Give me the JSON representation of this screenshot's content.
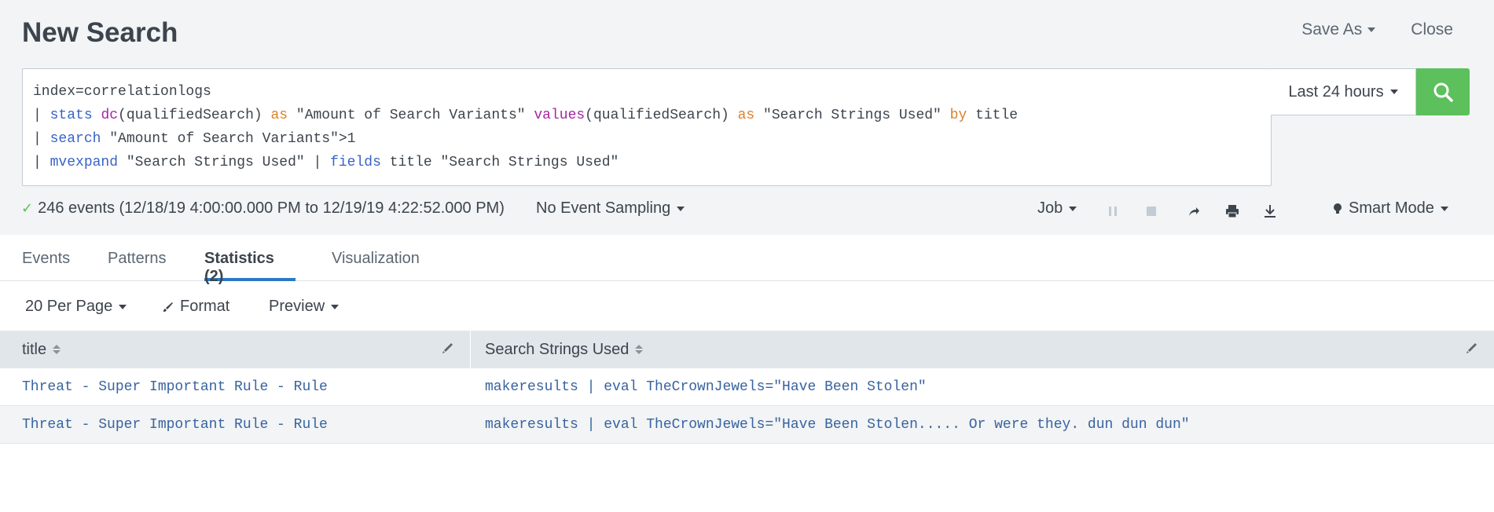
{
  "header": {
    "title": "New Search",
    "save_as": "Save As",
    "close": "Close"
  },
  "search": {
    "lines": [
      [
        {
          "t": "index=correlationlogs",
          "c": ""
        }
      ],
      [
        {
          "t": "| ",
          "c": ""
        },
        {
          "t": "stats",
          "c": "blue"
        },
        {
          "t": " ",
          "c": ""
        },
        {
          "t": "dc",
          "c": "purple"
        },
        {
          "t": "(qualifiedSearch) ",
          "c": ""
        },
        {
          "t": "as",
          "c": "orange"
        },
        {
          "t": " \"Amount of Search Variants\" ",
          "c": ""
        },
        {
          "t": "values",
          "c": "purple"
        },
        {
          "t": "(qualifiedSearch) ",
          "c": ""
        },
        {
          "t": "as",
          "c": "orange"
        },
        {
          "t": " \"Search Strings Used\" ",
          "c": ""
        },
        {
          "t": "by",
          "c": "orange"
        },
        {
          "t": " title",
          "c": ""
        }
      ],
      [
        {
          "t": "| ",
          "c": ""
        },
        {
          "t": "search",
          "c": "blue"
        },
        {
          "t": " \"Amount of Search Variants\">1",
          "c": ""
        }
      ],
      [
        {
          "t": "| ",
          "c": ""
        },
        {
          "t": "mvexpand",
          "c": "blue"
        },
        {
          "t": " \"Search Strings Used\" | ",
          "c": ""
        },
        {
          "t": "fields",
          "c": "blue"
        },
        {
          "t": " title \"Search Strings Used\"",
          "c": ""
        }
      ]
    ],
    "time_range": "Last 24 hours",
    "search_icon": "search-icon"
  },
  "status": {
    "summary": "246 events (12/18/19 4:00:00.000 PM to 12/19/19 4:22:52.000 PM)",
    "sampling": "No Event Sampling",
    "job": "Job",
    "mode": "Smart Mode",
    "icons": [
      "pause-icon",
      "stop-icon",
      "share-icon",
      "print-icon",
      "export-icon",
      "lightbulb-icon"
    ]
  },
  "tabs": [
    {
      "label": "Events"
    },
    {
      "label": "Patterns"
    },
    {
      "label": "Statistics (2)"
    },
    {
      "label": "Visualization"
    }
  ],
  "toolbar": {
    "per_page": "20 Per Page",
    "format": "Format",
    "preview": "Preview"
  },
  "table": {
    "columns": [
      "title",
      "Search Strings Used"
    ],
    "rows": [
      [
        "Threat - Super Important Rule - Rule",
        "makeresults | eval TheCrownJewels=\"Have Been Stolen\""
      ],
      [
        "Threat - Super Important Rule - Rule",
        "makeresults | eval TheCrownJewels=\"Have Been Stolen..... Or were they. dun dun dun\""
      ]
    ]
  },
  "colors": {
    "accent_green": "#5cc05c",
    "tab_underline": "#2a7ac2",
    "link_text": "#3863a0"
  }
}
